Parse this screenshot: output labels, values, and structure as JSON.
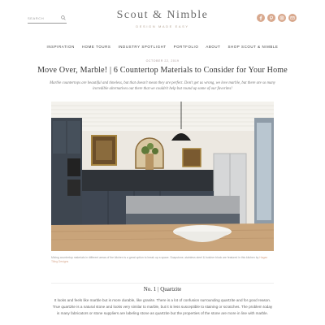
{
  "header": {
    "search_placeholder": "SEARCH",
    "brand": "Scout & Nimble",
    "tagline": "DESIGN MADE EASY",
    "social": [
      {
        "icon": "facebook-icon"
      },
      {
        "icon": "pinterest-icon"
      },
      {
        "icon": "instagram-icon"
      },
      {
        "icon": "email-icon"
      }
    ],
    "accent_color": "#d8a88d"
  },
  "nav": {
    "items": [
      "INSPIRATION",
      "HOME TOURS",
      "INDUSTRY SPOTLIGHT",
      "PORTFOLIO",
      "ABOUT",
      "SHOP SCOUT & NIMBLE"
    ]
  },
  "post": {
    "date": "OCTOBER 22, 2019",
    "title": "Move Over, Marble! | 6 Countertop Materials to Consider for Your Home",
    "intro": "Marble countertops are beautiful and timeless, but that doesn't mean they are perfect. Don't get us wrong, we love marble, but there are so many incredible alternatives out there that we couldn't help but round up some of our favorites!",
    "caption": "Mixing countertop materials in different areas of the kitchen is a great option to break up a space. Soapstone, stainless steel & butcher block are featured in this kitchen by",
    "caption_credit": "Hagan Tiling Designs",
    "section_title": "No. 1 | Quartzite",
    "body": "It looks and feels like marble but is more durable, like granite. There is a lot of confusion surrounding quartzite and for good reason. True quartzite is a natural stone and looks very similar to marble, but it is less susceptible to staining or scratches. The problem today is many fabricators or stone suppliers are labeling stone as quartzite but the properties of the stone are more in line with marble."
  }
}
